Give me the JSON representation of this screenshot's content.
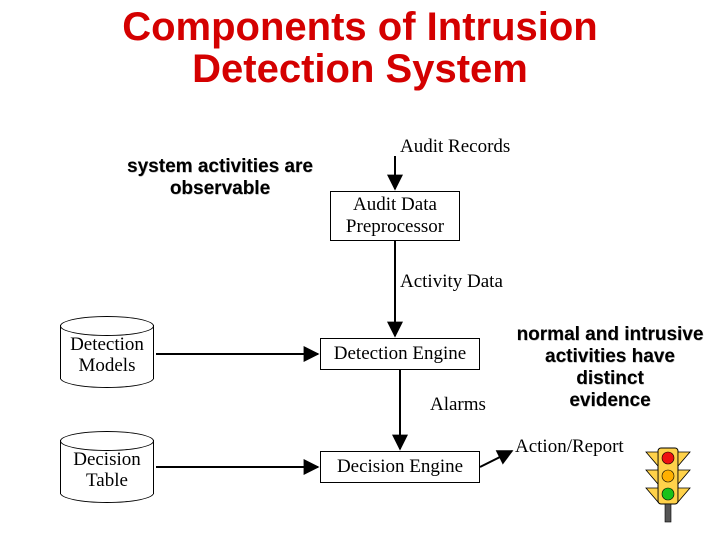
{
  "title_line1": "Components of Intrusion",
  "title_line2": "Detection System",
  "annot_left": "system activities are\nobservable",
  "annot_right": "normal and intrusive\nactivities have distinct\nevidence",
  "labels": {
    "audit_records": "Audit Records",
    "activity_data": "Activity Data",
    "alarms": "Alarms",
    "action_report": "Action/Report"
  },
  "boxes": {
    "preproc": "Audit Data\nPreprocessor",
    "detect": "Detection Engine",
    "decision": "Decision Engine"
  },
  "cylinders": {
    "models": "Detection\nModels",
    "table": "Decision\nTable"
  }
}
